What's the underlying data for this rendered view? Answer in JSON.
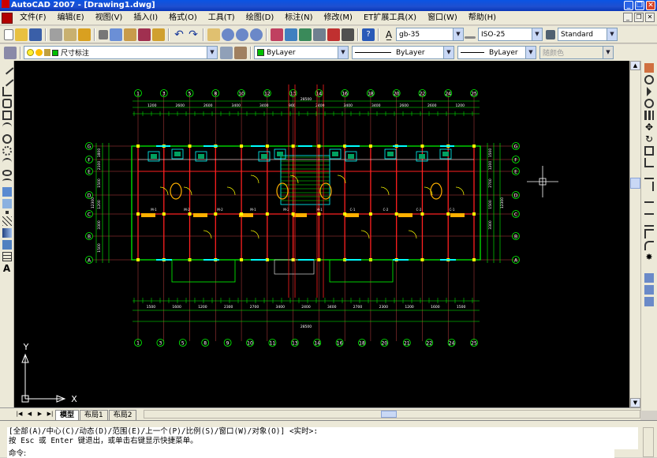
{
  "window": {
    "title": "AutoCAD 2007 - [Drawing1.dwg]",
    "minimize": "_",
    "restore": "❐",
    "close": "✕"
  },
  "menu": [
    "文件(F)",
    "编辑(E)",
    "视图(V)",
    "插入(I)",
    "格式(O)",
    "工具(T)",
    "绘图(D)",
    "标注(N)",
    "修改(M)",
    "ET扩展工具(X)",
    "窗口(W)",
    "帮助(H)"
  ],
  "styles": {
    "text_style": "gb-35",
    "dim_style": "ISO-25",
    "table_style": "Standard"
  },
  "layers": {
    "current_layer": "尺寸标注",
    "color": "ByLayer",
    "linetype": "ByLayer",
    "lineweight": "ByLayer",
    "plot_style": "随颜色",
    "layer_color": "#00c000"
  },
  "tabs": [
    "模型",
    "布局1",
    "布局2"
  ],
  "command": {
    "line1": "[全部(A)/中心(C)/动态(D)/范围(E)/上一个(P)/比例(S)/窗口(W)/对象(O)] <实时>:",
    "line2": "按 Esc 或 Enter 键退出，或单击右键显示快捷菜单。",
    "prompt": "命令:"
  },
  "ucs": {
    "x_label": "X",
    "y_label": "Y"
  },
  "drawing": {
    "axis_top": [
      "1",
      "3",
      "5",
      "8",
      "10",
      "12",
      "13",
      "14",
      "16",
      "18",
      "20",
      "22",
      "24",
      "25"
    ],
    "axis_bottom": [
      "1",
      "3",
      "5",
      "8",
      "9",
      "10",
      "11",
      "13",
      "14",
      "16",
      "18",
      "20",
      "21",
      "22",
      "24",
      "25"
    ],
    "axis_left": [
      "G",
      "F",
      "E",
      "D",
      "C",
      "B",
      "A"
    ],
    "axis_right": [
      "G",
      "F",
      "E",
      "D",
      "C",
      "B",
      "A"
    ],
    "dims_top_1": [
      "1200",
      "2600",
      "2600",
      "3400",
      "3400",
      "900",
      "2400",
      "3400",
      "3400",
      "2600",
      "2600",
      "1200"
    ],
    "dims_top_total": "28500",
    "dims_bottom_1": [
      "1500",
      "1600",
      "1200",
      "2300",
      "2700",
      "3400",
      "2400",
      "3400",
      "2700",
      "2300",
      "1200",
      "1600",
      "1500"
    ],
    "dims_bottom_total": "28500",
    "dims_left": [
      "1800",
      "2100",
      "1500",
      "1200",
      "3300",
      "1500"
    ],
    "dims_left_total": "12300",
    "dims_right": [
      "1500",
      "1200",
      "2700",
      "1500",
      "3300"
    ],
    "dims_right_total": "12300",
    "room_labels": [
      "M-1",
      "M-2",
      "M-2",
      "M-1",
      "M-2",
      "M-1",
      "C-1",
      "C-2",
      "C-2",
      "C-1"
    ]
  }
}
